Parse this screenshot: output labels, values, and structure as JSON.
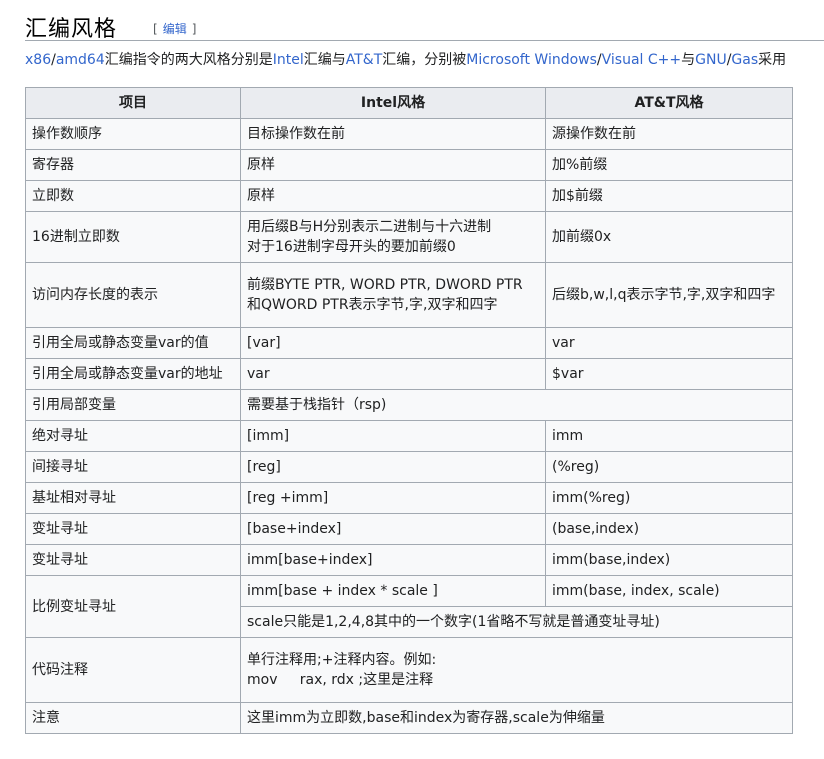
{
  "heading": {
    "title": "汇编风格",
    "edit_open": "[",
    "edit_label": "编辑",
    "edit_close": "]"
  },
  "intro": {
    "parts": [
      {
        "text": "x86",
        "link": true
      },
      {
        "text": "/",
        "link": false
      },
      {
        "text": "amd64",
        "link": true
      },
      {
        "text": "汇编指令的两大风格分别是",
        "link": false
      },
      {
        "text": "Intel",
        "link": true
      },
      {
        "text": "汇编与",
        "link": false
      },
      {
        "text": "AT&T",
        "link": true
      },
      {
        "text": "汇编，分别被",
        "link": false
      },
      {
        "text": "Microsoft Windows",
        "link": true
      },
      {
        "text": "/",
        "link": false
      },
      {
        "text": "Visual C++",
        "link": true
      },
      {
        "text": "与",
        "link": false
      },
      {
        "text": "GNU",
        "link": true
      },
      {
        "text": "/",
        "link": false
      },
      {
        "text": "Gas",
        "link": true
      },
      {
        "text": "采用",
        "link": false
      }
    ]
  },
  "table": {
    "headers": [
      "项目",
      "Intel风格",
      "AT&T风格"
    ],
    "rows": {
      "operand_order": [
        "操作数顺序",
        "目标操作数在前",
        "源操作数在前"
      ],
      "register": [
        "寄存器",
        "原样",
        "加%前缀"
      ],
      "immediate": [
        "立即数",
        "原样",
        "加$前缀"
      ],
      "hex_immediate": [
        "16进制立即数",
        "用后缀B与H分别表示二进制与十六进制",
        "对于16进制字母开头的要加前缀0",
        "加前缀0x"
      ],
      "mem_size": [
        "访问内存长度的表示",
        "前缀BYTE PTR, WORD PTR, DWORD PTR",
        "和QWORD PTR表示字节,字,双字和四字",
        "后缀b,w,l,q表示字节,字,双字和四字"
      ],
      "global_value": [
        "引用全局或静态变量var的值",
        "[var]",
        "var"
      ],
      "global_addr": [
        "引用全局或静态变量var的地址",
        "var",
        "$var"
      ],
      "local_var": [
        "引用局部变量",
        "需要基于栈指针（rsp)"
      ],
      "absolute": [
        "绝对寻址",
        "[imm]",
        "imm"
      ],
      "indirect": [
        "间接寻址",
        "[reg]",
        "(%reg)"
      ],
      "base_relative": [
        "基址相对寻址",
        "[reg +imm]",
        "imm(%reg)"
      ],
      "indexed1": [
        "变址寻址",
        "[base+index]",
        "(base,index)"
      ],
      "indexed2": [
        "变址寻址",
        "imm[base+index]",
        "imm(base,index)"
      ],
      "scaled": [
        "比例变址寻址",
        "imm[base + index * scale ]",
        "imm(base, index, scale)",
        "scale只能是1,2,4,8其中的一个数字(1省略不写就是普通变址寻址)"
      ],
      "comment": [
        "代码注释",
        "单行注释用;+注释内容。例如:",
        "mov     rax, rdx ;这里是注释"
      ],
      "note": [
        "注意",
        "这里imm为立即数,base和index为寄存器,scale为伸缩量"
      ]
    }
  }
}
